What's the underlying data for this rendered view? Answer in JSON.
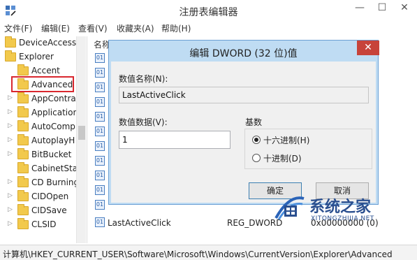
{
  "window": {
    "title": "注册表编辑器",
    "min": "—",
    "max": "☐",
    "close": "✕"
  },
  "menu": [
    "文件(F)",
    "编辑(E)",
    "查看(V)",
    "收藏夹(A)",
    "帮助(H)"
  ],
  "tree": {
    "items": [
      {
        "label": "DeviceAccess"
      },
      {
        "label": "Explorer"
      },
      {
        "label": "Accent"
      },
      {
        "label": "Advanced"
      },
      {
        "label": "AppContra"
      },
      {
        "label": "Application"
      },
      {
        "label": "AutoComp"
      },
      {
        "label": "AutoplayH"
      },
      {
        "label": "BitBucket"
      },
      {
        "label": "CabinetSta"
      },
      {
        "label": "CD Burning"
      },
      {
        "label": "CIDOpen"
      },
      {
        "label": "CIDSave"
      },
      {
        "label": "CLSID"
      }
    ]
  },
  "list": {
    "column_name": "名称",
    "visible_row": {
      "name": "LastActiveClick",
      "type": "REG_DWORD",
      "data": "0x00000000 (0)"
    }
  },
  "dialog": {
    "title": "编辑 DWORD (32 位)值",
    "close": "✕",
    "name_label": "数值名称(N):",
    "name_value": "LastActiveClick",
    "data_label": "数值数据(V):",
    "data_value": "1",
    "base_label": "基数",
    "base_options": [
      {
        "label": "十六进制(H)",
        "checked": true
      },
      {
        "label": "十进制(D)",
        "checked": false
      }
    ],
    "ok": "确定",
    "cancel": "取消"
  },
  "statusbar": {
    "path": "计算机\\HKEY_CURRENT_USER\\Software\\Microsoft\\Windows\\CurrentVersion\\Explorer\\Advanced"
  },
  "watermark": {
    "cn": "系统之家",
    "en": "XITONGZHIJIA.NET"
  },
  "colors": {
    "highlight_border": "#d9282f",
    "dialog_frame": "#bfdcf3",
    "close_red": "#c7433a"
  }
}
